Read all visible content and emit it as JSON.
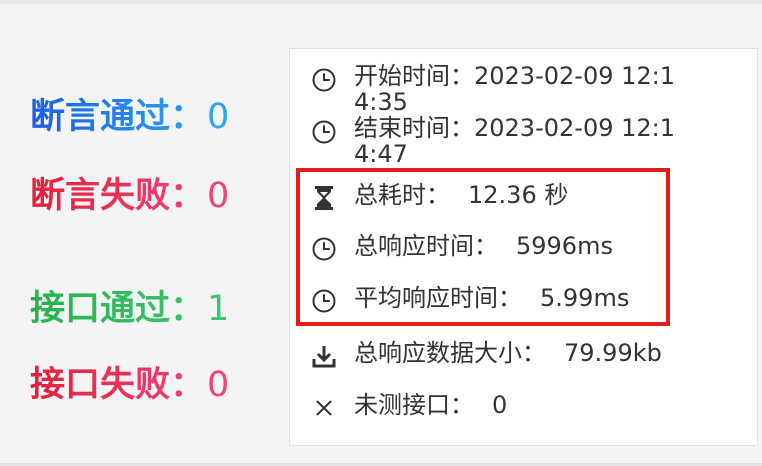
{
  "summary": {
    "assert_pass": {
      "label": "断言通过：",
      "value": "0"
    },
    "assert_fail": {
      "label": "断言失败：",
      "value": "0"
    },
    "api_pass": {
      "label": "接口通过：",
      "value": "1"
    },
    "api_fail": {
      "label": "接口失败：",
      "value": "0"
    }
  },
  "details": {
    "start": {
      "label": "开始时间：",
      "value": "2023-02-09 12:14:35",
      "icon": "clock-icon"
    },
    "end": {
      "label": "结束时间：",
      "value": "2023-02-09 12:14:47",
      "icon": "clock-icon"
    },
    "total_time": {
      "label": "总耗时：",
      "value": "12.36 秒",
      "icon": "hourglass-icon"
    },
    "total_response": {
      "label": "总响应时间：",
      "value": "5996ms",
      "icon": "clock-icon"
    },
    "avg_response": {
      "label": "平均响应时间：",
      "value": "5.99ms",
      "icon": "clock-icon"
    },
    "total_size": {
      "label": "总响应数据大小：",
      "value": "79.99kb",
      "icon": "download-icon"
    },
    "untested": {
      "label": "未测接口：",
      "value": "0",
      "icon": "close-icon"
    }
  },
  "colors": {
    "highlight_border": "#e21b1b",
    "pass_blue": "#2a9df4",
    "fail_pink": "#f0437a",
    "pass_green": "#3dc36c"
  }
}
